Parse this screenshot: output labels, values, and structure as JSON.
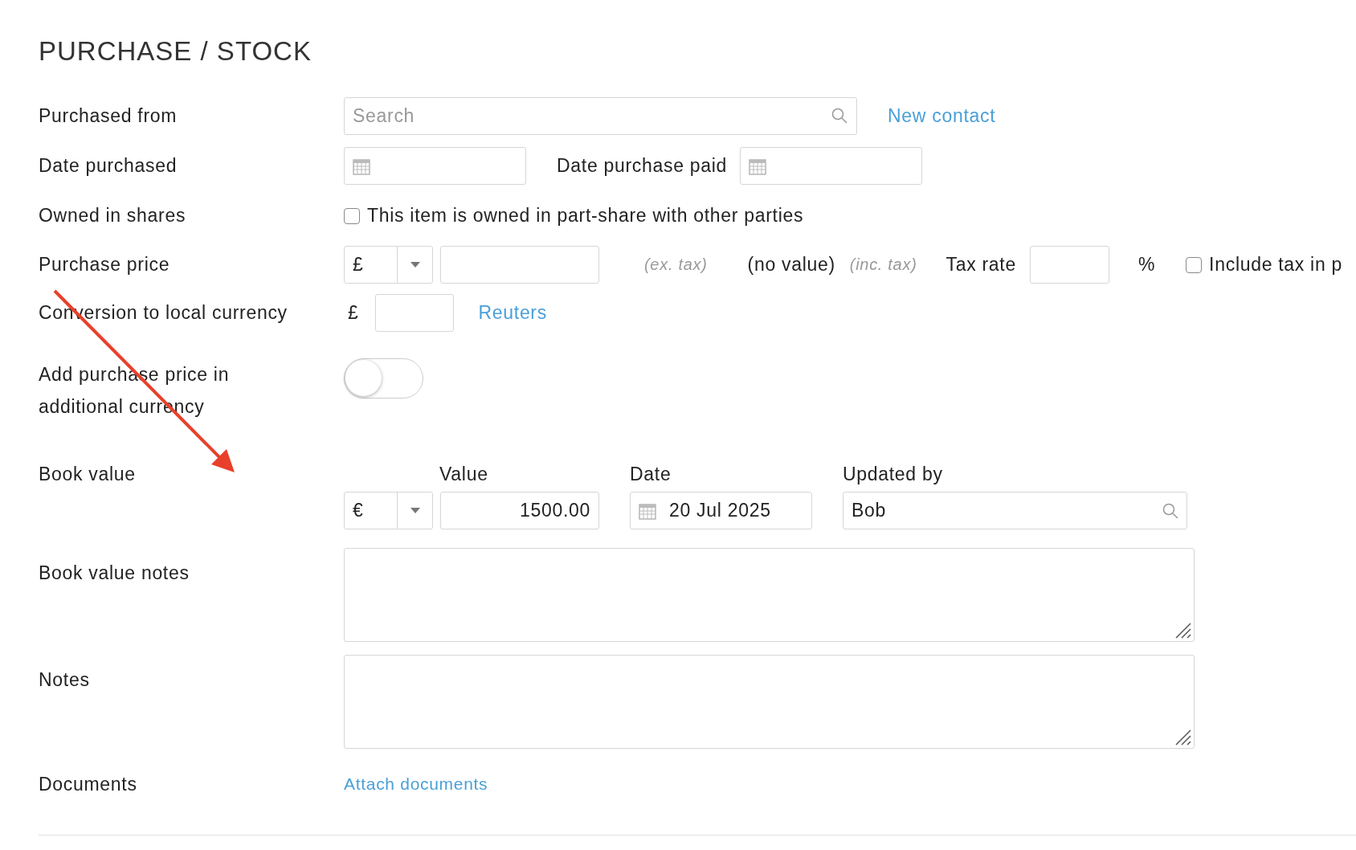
{
  "title": "PURCHASE / STOCK",
  "purchased_from": {
    "label": "Purchased from",
    "placeholder": "Search",
    "link": "New contact"
  },
  "date_purchased": {
    "label": "Date purchased",
    "paid_label": "Date purchase paid"
  },
  "owned_in_shares": {
    "label": "Owned in shares",
    "checkbox_label": "This item is owned in part-share with other parties",
    "checked": false
  },
  "purchase_price": {
    "label": "Purchase price",
    "currency": "£",
    "ex_tax": "(ex. tax)",
    "computed": "(no value)",
    "inc_tax": "(inc. tax)",
    "tax_rate_label": "Tax rate",
    "percent": "%",
    "include_tax_label": "Include tax in p",
    "include_tax_checked": false
  },
  "conversion": {
    "label": "Conversion to local currency",
    "currency": "£",
    "link": "Reuters"
  },
  "additional_currency": {
    "label": "Add purchase price in additional currency",
    "on": false
  },
  "book_value": {
    "label": "Book value",
    "columns": [
      "Value",
      "Date",
      "Updated by"
    ],
    "currency": "€",
    "value": "1500.00",
    "date": "20 Jul 2025",
    "updated_by": "Bob"
  },
  "book_value_notes": {
    "label": "Book value notes"
  },
  "notes": {
    "label": "Notes"
  },
  "documents": {
    "label": "Documents",
    "link": "Attach documents"
  }
}
